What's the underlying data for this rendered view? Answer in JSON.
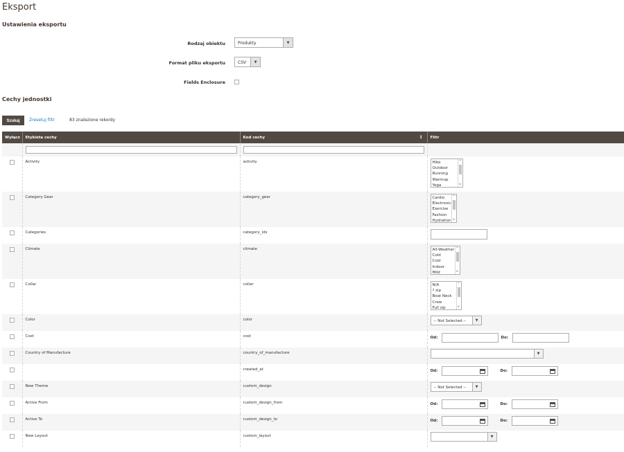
{
  "page": {
    "title": "Eksport",
    "export_settings_title": "Ustawienia eksportu",
    "entity_attributes_title": "Cechy jednostki"
  },
  "form": {
    "entity_type_label": "Rodzaj obiektu",
    "entity_type_value": "Produkty",
    "file_format_label": "Format pliku eksportu",
    "file_format_value": "CSV",
    "fields_enclosure_label": "Fields Enclosure"
  },
  "toolbar": {
    "search_label": "Szukaj",
    "reset_label": "Zresetuj filtr",
    "records_text": "83 znalezione rekordy"
  },
  "grid": {
    "headers": [
      "Wyłącz",
      "Etykieta cechy",
      "Kod cechy",
      "Filtr"
    ],
    "sort_icon": "↕",
    "range_from": "Od:",
    "range_to": "Do:",
    "rows": [
      {
        "label": "Activity",
        "code": "activity",
        "filter": {
          "type": "multiselect",
          "options": [
            "Hike",
            "Outdoor",
            "Running",
            "Warmup",
            "Yoga"
          ]
        }
      },
      {
        "label": "Category Gear",
        "code": "category_gear",
        "filter": {
          "type": "multiselect",
          "options": [
            "Cardio",
            "Electronic",
            "Exercise",
            "Fashion",
            "Hydration"
          ]
        }
      },
      {
        "label": "Categories",
        "code": "category_ids",
        "filter": {
          "type": "text"
        }
      },
      {
        "label": "Climate",
        "code": "climate",
        "filter": {
          "type": "multiselect",
          "options": [
            "All-Weather",
            "Cold",
            "Cool",
            "Indoor",
            "Mild"
          ]
        }
      },
      {
        "label": "Collar",
        "code": "collar",
        "filter": {
          "type": "multiselect",
          "options": [
            "N/A",
            "? zip",
            "Boat Neck",
            "Crew",
            "Full zip"
          ]
        }
      },
      {
        "label": "Color",
        "code": "color",
        "filter": {
          "type": "select",
          "value": "-- Not Selected --"
        }
      },
      {
        "label": "Cost",
        "code": "cost",
        "filter": {
          "type": "range"
        }
      },
      {
        "label": "Country of Manufacture",
        "code": "country_of_manufacture",
        "filter": {
          "type": "select-wide",
          "value": ""
        }
      },
      {
        "label": "",
        "code": "created_at",
        "filter": {
          "type": "date-range"
        }
      },
      {
        "label": "New Theme",
        "code": "custom_design",
        "filter": {
          "type": "select",
          "value": "-- Not Selected --"
        }
      },
      {
        "label": "Active From",
        "code": "custom_design_from",
        "filter": {
          "type": "date-range"
        }
      },
      {
        "label": "Active To",
        "code": "custom_design_to",
        "filter": {
          "type": "date-range"
        }
      },
      {
        "label": "New Layout",
        "code": "custom_layout",
        "filter": {
          "type": "select-mid",
          "value": ""
        }
      }
    ]
  }
}
